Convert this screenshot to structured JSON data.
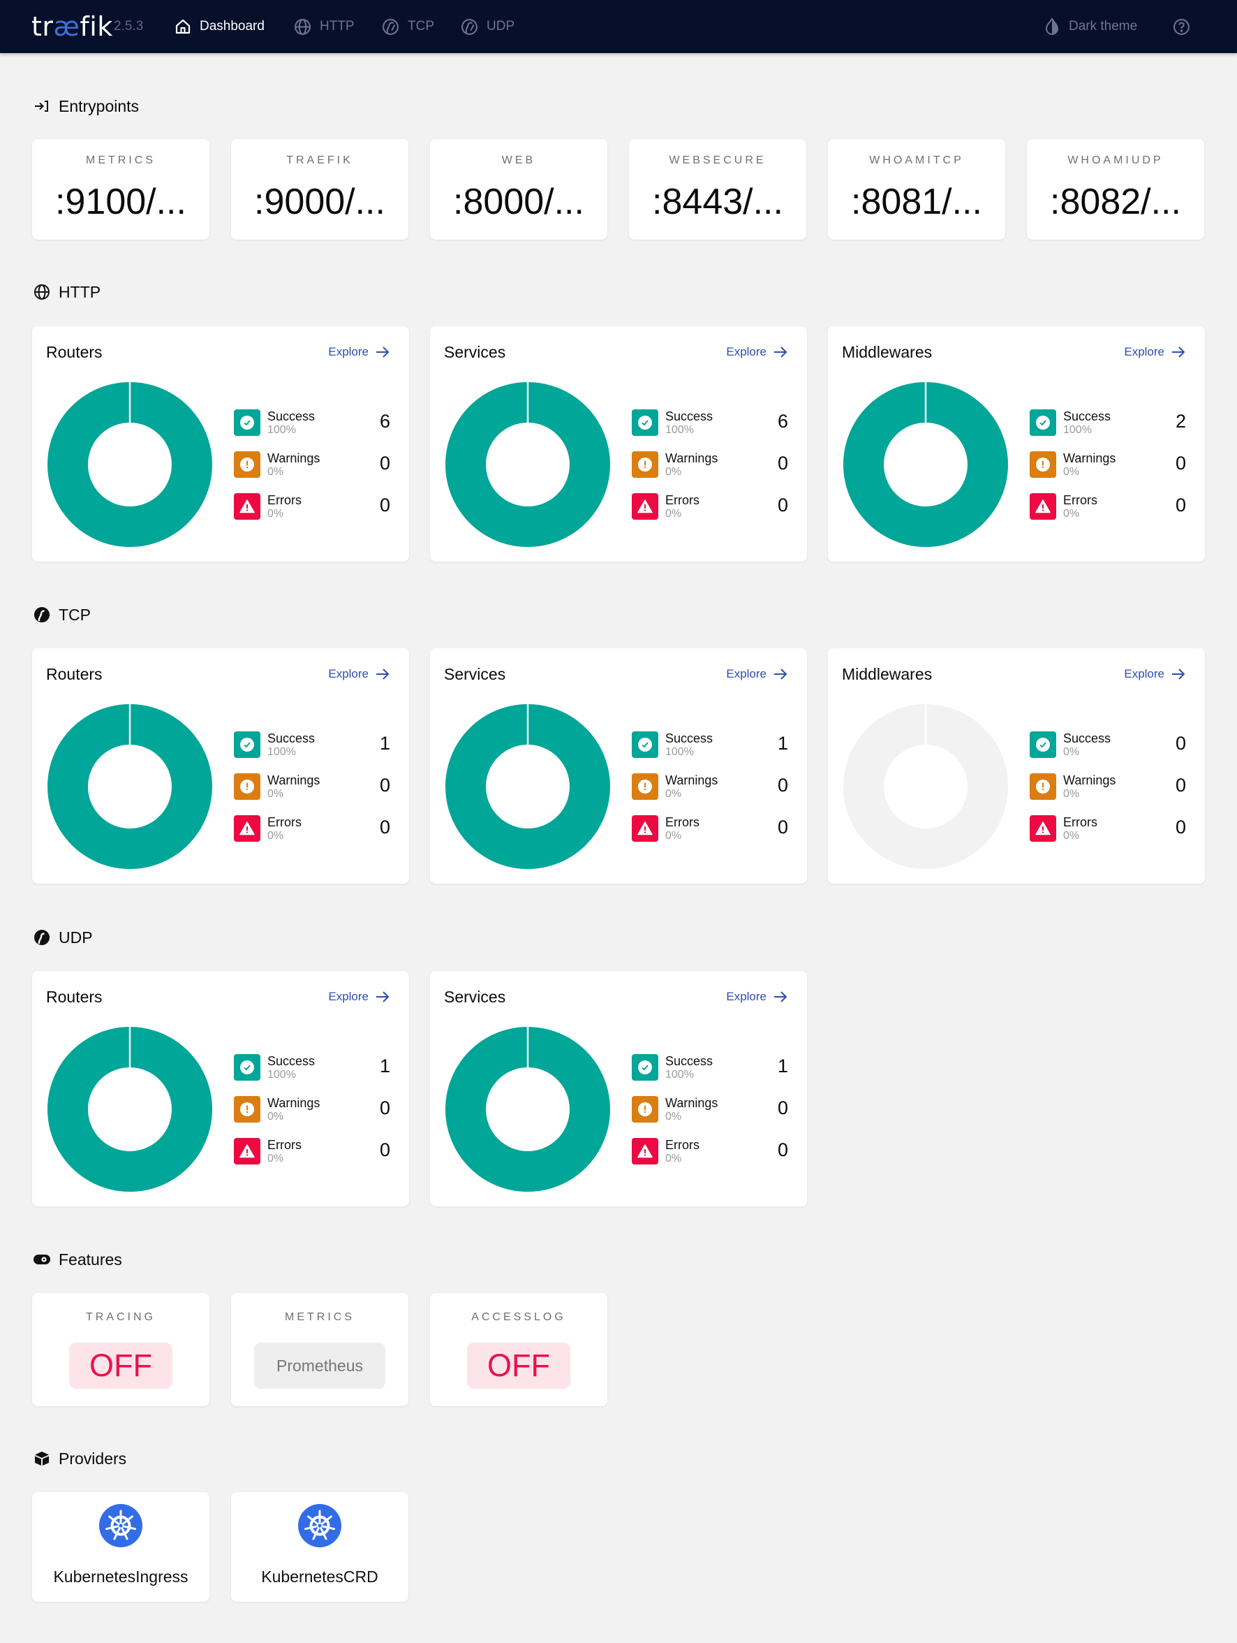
{
  "header": {
    "logo_prefix": "tr",
    "logo_ae": "æ",
    "logo_suffix": "fik",
    "version": "2.5.3",
    "nav": [
      {
        "label": "Dashboard",
        "icon": "home-icon",
        "active": true
      },
      {
        "label": "HTTP",
        "icon": "globe-icon",
        "active": false
      },
      {
        "label": "TCP",
        "icon": "tcp-icon",
        "active": false
      },
      {
        "label": "UDP",
        "icon": "udp-icon",
        "active": false
      }
    ],
    "theme_label": "Dark theme",
    "help_icon": "help-icon"
  },
  "colors": {
    "header_bg": "#06102b",
    "page_bg": "#f2f2f3",
    "success": "#00a697",
    "warning": "#db7d11",
    "error": "#ed0a42",
    "empty": "#f2f2f2",
    "link": "#2e4cb3",
    "kubernetes": "#326de6"
  },
  "entrypoints": {
    "title": "Entrypoints",
    "items": [
      {
        "name": "METRICS",
        "value": ":9100/..."
      },
      {
        "name": "TRAEFIK",
        "value": ":9000/..."
      },
      {
        "name": "WEB",
        "value": ":8000/..."
      },
      {
        "name": "WEBSECURE",
        "value": ":8443/..."
      },
      {
        "name": "WHOAMITCP",
        "value": ":8081/..."
      },
      {
        "name": "WHOAMIUDP",
        "value": ":8082/..."
      }
    ]
  },
  "legend_labels": {
    "success": "Success",
    "warnings": "Warnings",
    "errors": "Errors"
  },
  "explore_label": "Explore",
  "http": {
    "title": "HTTP",
    "cards": [
      {
        "title": "Routers",
        "success": 6,
        "success_pct": "100%",
        "warnings": 0,
        "warnings_pct": "0%",
        "errors": 0,
        "errors_pct": "0%"
      },
      {
        "title": "Services",
        "success": 6,
        "success_pct": "100%",
        "warnings": 0,
        "warnings_pct": "0%",
        "errors": 0,
        "errors_pct": "0%"
      },
      {
        "title": "Middlewares",
        "success": 2,
        "success_pct": "100%",
        "warnings": 0,
        "warnings_pct": "0%",
        "errors": 0,
        "errors_pct": "0%"
      }
    ]
  },
  "tcp": {
    "title": "TCP",
    "cards": [
      {
        "title": "Routers",
        "success": 1,
        "success_pct": "100%",
        "warnings": 0,
        "warnings_pct": "0%",
        "errors": 0,
        "errors_pct": "0%"
      },
      {
        "title": "Services",
        "success": 1,
        "success_pct": "100%",
        "warnings": 0,
        "warnings_pct": "0%",
        "errors": 0,
        "errors_pct": "0%"
      },
      {
        "title": "Middlewares",
        "success": 0,
        "success_pct": "0%",
        "warnings": 0,
        "warnings_pct": "0%",
        "errors": 0,
        "errors_pct": "0%"
      }
    ]
  },
  "udp": {
    "title": "UDP",
    "cards": [
      {
        "title": "Routers",
        "success": 1,
        "success_pct": "100%",
        "warnings": 0,
        "warnings_pct": "0%",
        "errors": 0,
        "errors_pct": "0%"
      },
      {
        "title": "Services",
        "success": 1,
        "success_pct": "100%",
        "warnings": 0,
        "warnings_pct": "0%",
        "errors": 0,
        "errors_pct": "0%"
      }
    ]
  },
  "features": {
    "title": "Features",
    "items": [
      {
        "name": "TRACING",
        "value": "OFF",
        "state": "off"
      },
      {
        "name": "METRICS",
        "value": "Prometheus",
        "state": "neutral"
      },
      {
        "name": "ACCESSLOG",
        "value": "OFF",
        "state": "off"
      }
    ]
  },
  "providers": {
    "title": "Providers",
    "items": [
      {
        "name": "KubernetesIngress",
        "icon": "kubernetes-icon"
      },
      {
        "name": "KubernetesCRD",
        "icon": "kubernetes-icon"
      }
    ]
  }
}
